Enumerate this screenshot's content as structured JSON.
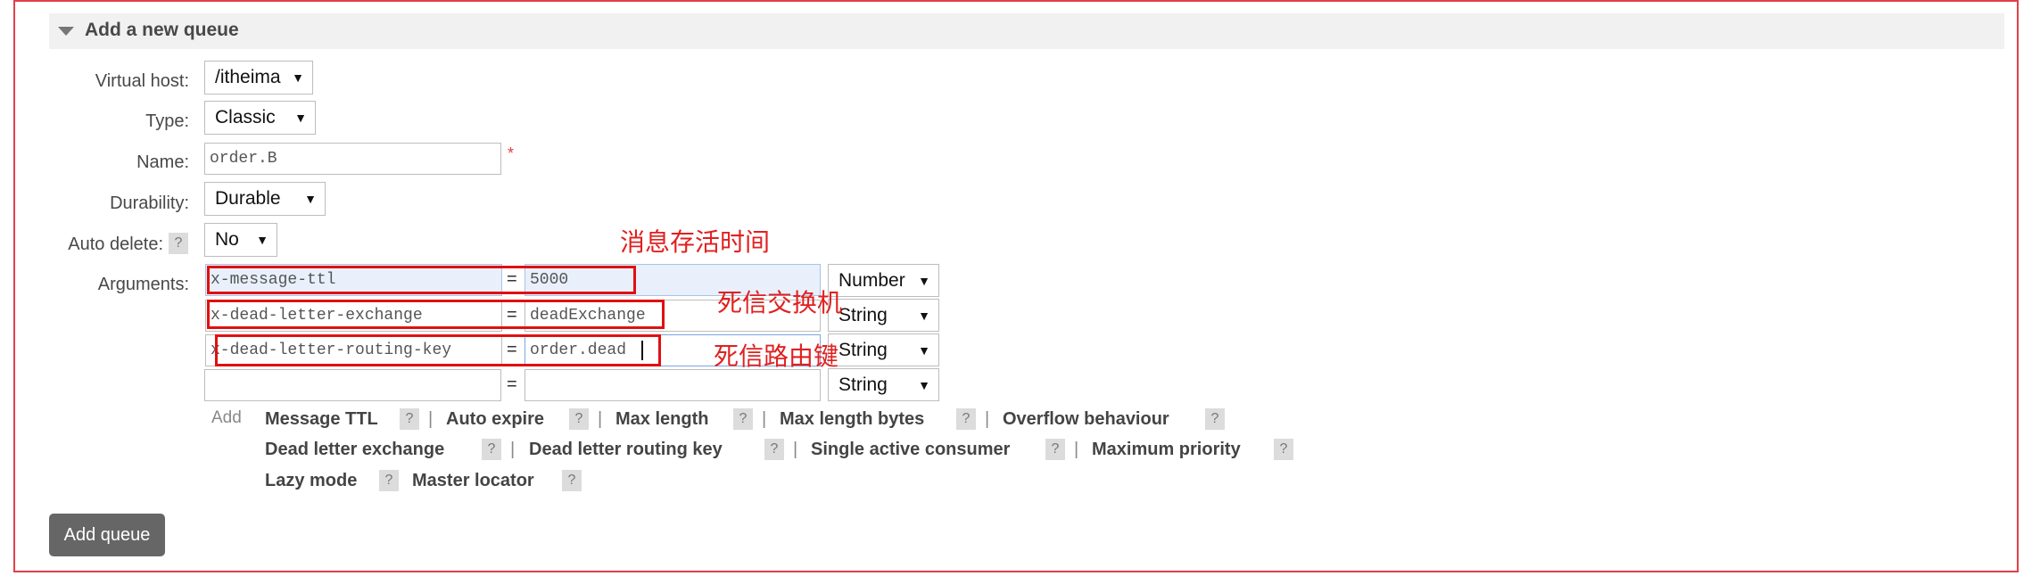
{
  "section": {
    "title": "Add a new queue"
  },
  "form": {
    "virtual_host": {
      "label": "Virtual host:",
      "value": "/itheima"
    },
    "type": {
      "label": "Type:",
      "value": "Classic"
    },
    "name": {
      "label": "Name:",
      "value": "order.B",
      "required_mark": "*"
    },
    "durability": {
      "label": "Durability:",
      "value": "Durable"
    },
    "auto_delete": {
      "label": "Auto delete:",
      "help": "?",
      "value": "No"
    },
    "arguments": {
      "label": "Arguments:",
      "equals": "=",
      "rows": [
        {
          "key": "x-message-ttl",
          "value": "5000",
          "type": "Number"
        },
        {
          "key": "x-dead-letter-exchange",
          "value": "deadExchange",
          "type": "String"
        },
        {
          "key": "x-dead-letter-routing-key",
          "value": "order.dead",
          "type": "String"
        },
        {
          "key": "",
          "value": "",
          "type": "String"
        }
      ]
    }
  },
  "annotations": {
    "ttl_note": "消息存活时间",
    "exchange_note": "死信交换机",
    "routing_note": "死信路由键"
  },
  "hints": {
    "add_label": "Add",
    "help": "?",
    "separator": "|",
    "items": [
      "Message TTL",
      "Auto expire",
      "Max length",
      "Max length bytes",
      "Overflow behaviour",
      "Dead letter exchange",
      "Dead letter routing key",
      "Single active consumer",
      "Maximum priority",
      "Lazy mode",
      "Master locator"
    ]
  },
  "actions": {
    "add_queue": "Add queue"
  },
  "colors": {
    "annotation": "#e02020",
    "button": "#666666",
    "frame": "#e0404a"
  }
}
